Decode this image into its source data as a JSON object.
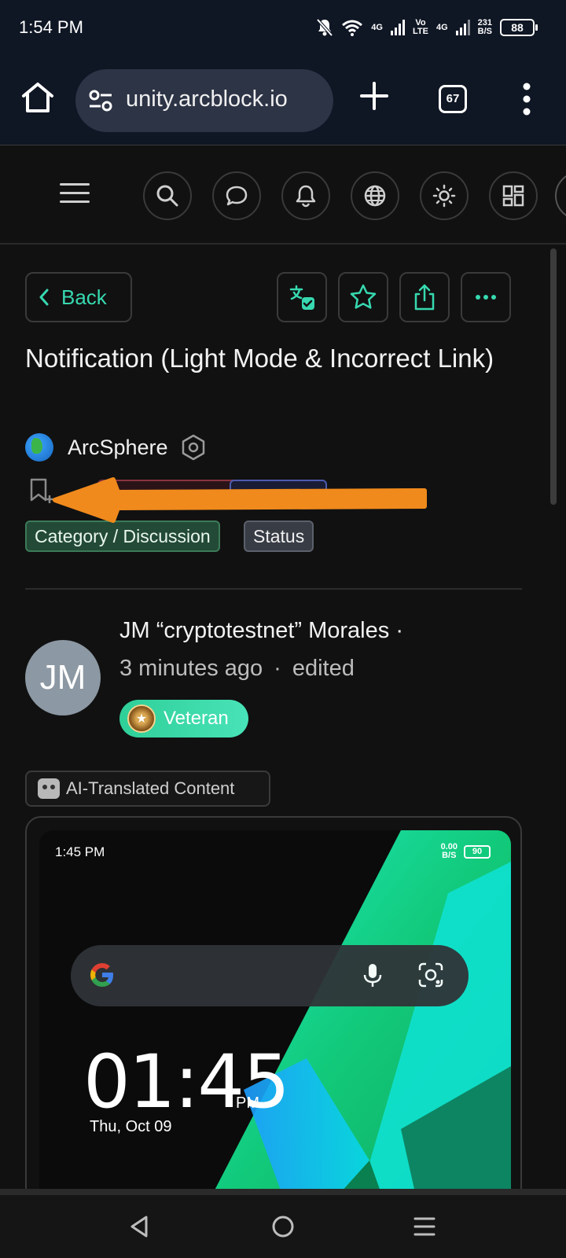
{
  "status_bar": {
    "time": "1:54 PM",
    "network_4g_1": "4G",
    "volte": "Vo\nLTE",
    "network_4g_2": "4G",
    "speed_value": "231",
    "speed_unit": "B/S",
    "battery": "88"
  },
  "browser": {
    "url": "unity.arcblock.io",
    "tab_count": "67"
  },
  "post": {
    "back_label": "Back",
    "title": "Notification (Light Mode & Incorrect Link)",
    "author_name": "ArcSphere",
    "views": "1 views",
    "tags": [
      "Category / Discussion",
      "Status"
    ],
    "poster_name": "JM “cryptotestnet” Morales ·",
    "time_ago": "3 minutes ago",
    "edited_label": "edited",
    "avatar_initials": "JM",
    "badge_label": "Veteran",
    "ai_label": "AI-Translated Content"
  },
  "embedded_screenshot": {
    "time": "1:45 PM",
    "speed_value": "0.00",
    "speed_unit": "B/S",
    "battery": "90",
    "clock": "01:45",
    "clock_suffix": "PM",
    "date": "Thu, Oct 09"
  },
  "colors": {
    "accent": "#37d9b0",
    "browser_chrome": "#0f1624",
    "page_bg": "#111111",
    "annotation_arrow": "#f08a1c"
  }
}
